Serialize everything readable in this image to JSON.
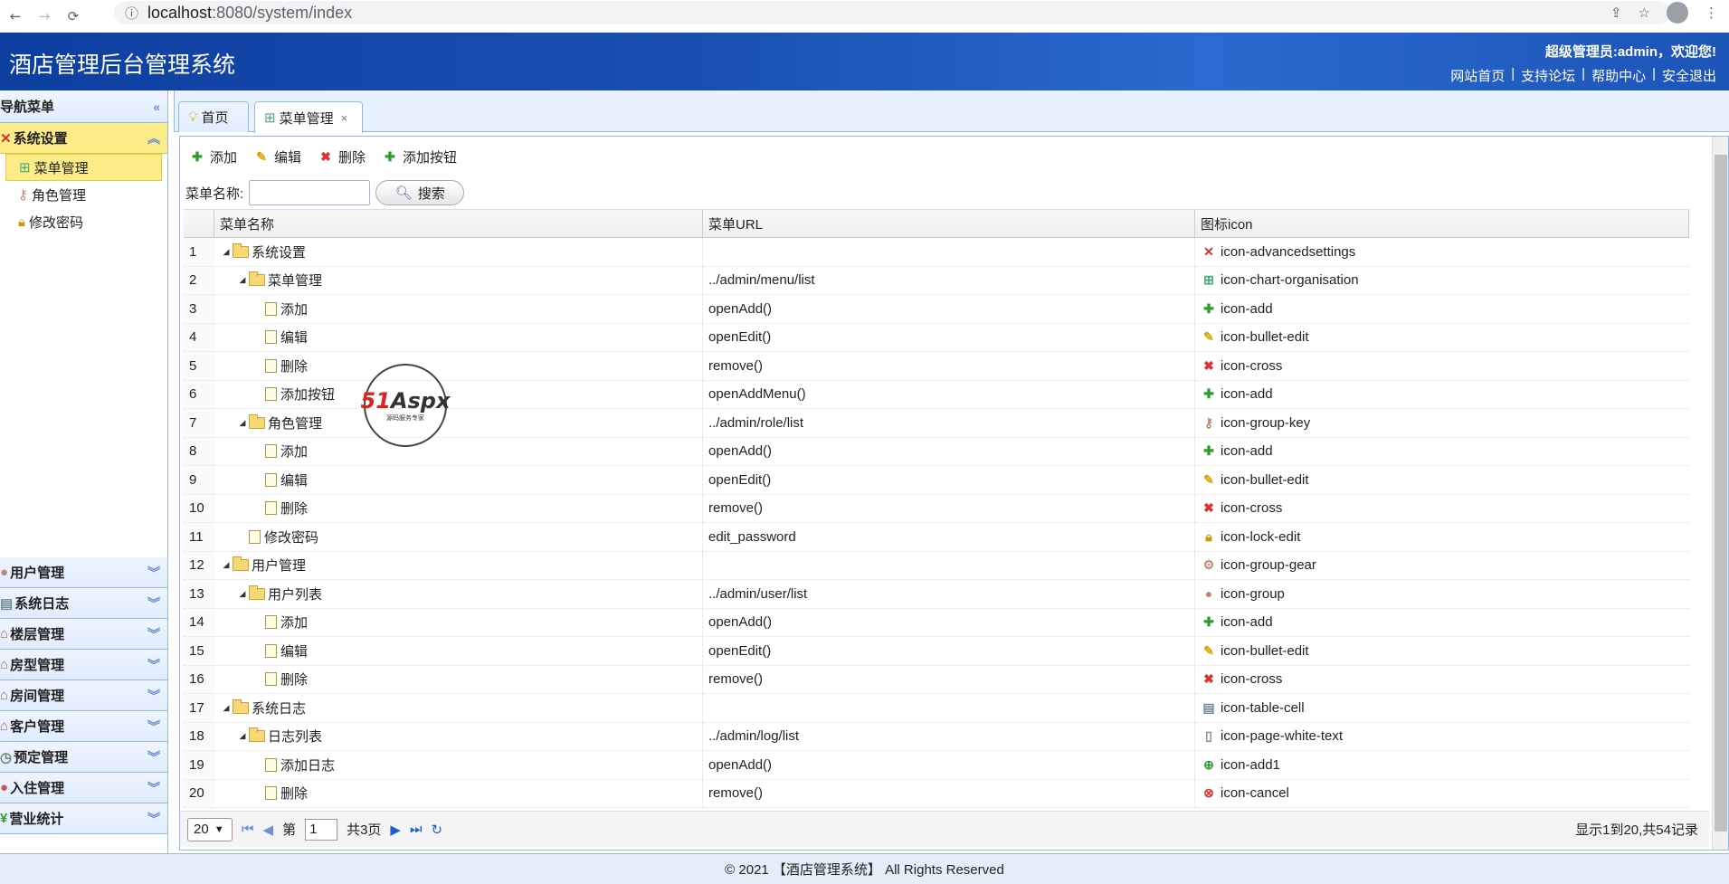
{
  "browser": {
    "url_host": "localhost",
    "url_rest": ":8080/system/index"
  },
  "header": {
    "title": "酒店管理后台管理系统",
    "welcome": "超级管理员:admin，欢迎您!",
    "links": [
      "网站首页",
      "支持论坛",
      "帮助中心",
      "安全退出"
    ],
    "separator": "|"
  },
  "sidebar": {
    "title": "导航菜单",
    "active_group": {
      "label": "系统设置",
      "items": [
        "菜单管理",
        "角色管理",
        "修改密码"
      ]
    },
    "groups": [
      "用户管理",
      "系统日志",
      "楼层管理",
      "房型管理",
      "房间管理",
      "客户管理",
      "预定管理",
      "入住管理",
      "营业统计"
    ]
  },
  "tabs": [
    {
      "label": "首页"
    },
    {
      "label": "菜单管理"
    }
  ],
  "toolbar": {
    "add": "添加",
    "edit": "编辑",
    "delete": "删除",
    "add_button": "添加按钮"
  },
  "search": {
    "label": "菜单名称:",
    "button": "搜索",
    "value": ""
  },
  "grid": {
    "columns": [
      "菜单名称",
      "菜单URL",
      "图标icon"
    ],
    "rows": [
      {
        "n": "1",
        "name": "系统设置",
        "url": "",
        "icon": "icon-advancedsettings"
      },
      {
        "n": "2",
        "name": "菜单管理",
        "url": "../admin/menu/list",
        "icon": "icon-chart-organisation"
      },
      {
        "n": "3",
        "name": "添加",
        "url": "openAdd()",
        "icon": "icon-add"
      },
      {
        "n": "4",
        "name": "编辑",
        "url": "openEdit()",
        "icon": "icon-bullet-edit"
      },
      {
        "n": "5",
        "name": "删除",
        "url": "remove()",
        "icon": "icon-cross"
      },
      {
        "n": "6",
        "name": "添加按钮",
        "url": "openAddMenu()",
        "icon": "icon-add"
      },
      {
        "n": "7",
        "name": "角色管理",
        "url": "../admin/role/list",
        "icon": "icon-group-key"
      },
      {
        "n": "8",
        "name": "添加",
        "url": "openAdd()",
        "icon": "icon-add"
      },
      {
        "n": "9",
        "name": "编辑",
        "url": "openEdit()",
        "icon": "icon-bullet-edit"
      },
      {
        "n": "10",
        "name": "删除",
        "url": "remove()",
        "icon": "icon-cross"
      },
      {
        "n": "11",
        "name": "修改密码",
        "url": "edit_password",
        "icon": "icon-lock-edit"
      },
      {
        "n": "12",
        "name": "用户管理",
        "url": "",
        "icon": "icon-group-gear"
      },
      {
        "n": "13",
        "name": "用户列表",
        "url": "../admin/user/list",
        "icon": "icon-group"
      },
      {
        "n": "14",
        "name": "添加",
        "url": "openAdd()",
        "icon": "icon-add"
      },
      {
        "n": "15",
        "name": "编辑",
        "url": "openEdit()",
        "icon": "icon-bullet-edit"
      },
      {
        "n": "16",
        "name": "删除",
        "url": "remove()",
        "icon": "icon-cross"
      },
      {
        "n": "17",
        "name": "系统日志",
        "url": "",
        "icon": "icon-table-cell"
      },
      {
        "n": "18",
        "name": "日志列表",
        "url": "../admin/log/list",
        "icon": "icon-page-white-text"
      },
      {
        "n": "19",
        "name": "添加日志",
        "url": "openAdd()",
        "icon": "icon-add1"
      },
      {
        "n": "20",
        "name": "删除",
        "url": "remove()",
        "icon": "icon-cancel"
      }
    ]
  },
  "pager": {
    "page_size": "20",
    "page_prefix": "第",
    "page": "1",
    "page_total": "共3页",
    "info": "显示1到20,共54记录"
  },
  "footer": {
    "text": "© 2021 【酒店管理系统】 All Rights Reserved"
  },
  "watermark": {
    "brand_a": "51",
    "brand_b": "Aspx",
    "sub": "源码服务专家"
  }
}
